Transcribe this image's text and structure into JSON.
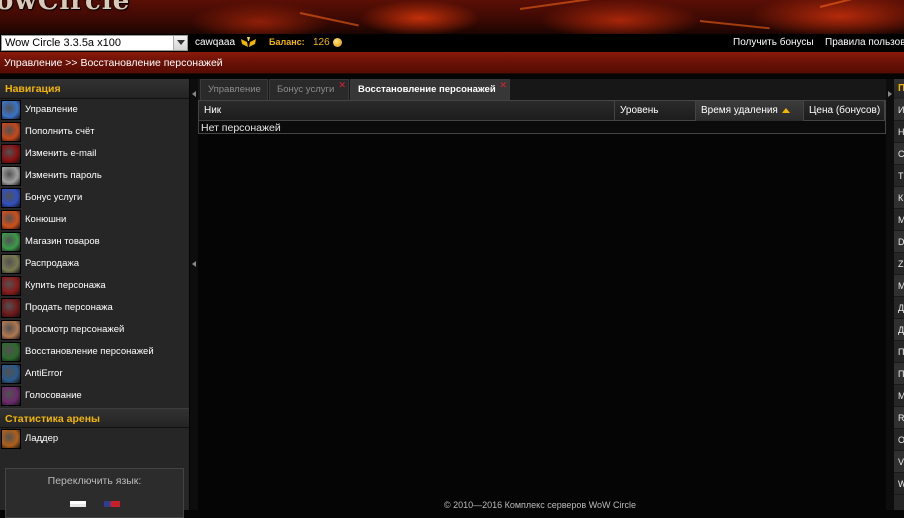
{
  "banner": {
    "logo_text": "owCircle"
  },
  "topbar": {
    "server_selected": "Wow Circle 3.3.5a x100",
    "username": "cawqaaa",
    "balance_label": "Баланс:",
    "balance_value": "126",
    "get_bonus_link": "Получить бонусы",
    "rules_link": "Правила пользов"
  },
  "breadcrumb": "Управление >> Восстановление персонажей",
  "sidebar": {
    "nav_title": "Навигация",
    "items": [
      {
        "label": "Управление",
        "icon": "shield-frost-icon",
        "color": "#3a74c8"
      },
      {
        "label": "Пополнить счёт",
        "icon": "fire-claw-icon",
        "color": "#c8481a"
      },
      {
        "label": "Изменить e-mail",
        "icon": "red-demon-icon",
        "color": "#8a1010"
      },
      {
        "label": "Изменить пароль",
        "icon": "grey-face-icon",
        "color": "#a0a0a0"
      },
      {
        "label": "Бонус услуги",
        "icon": "blue-sword-icon",
        "color": "#3050c0"
      },
      {
        "label": "Конюшни",
        "icon": "flame-horse-icon",
        "color": "#d0501a"
      },
      {
        "label": "Магазин товаров",
        "icon": "green-orb-icon",
        "color": "#3c9a4a"
      },
      {
        "label": "Распродажа",
        "icon": "potion-flask-icon",
        "color": "#7a7a50"
      },
      {
        "label": "Купить персонажа",
        "icon": "red-rune-icon",
        "color": "#8a1a1a"
      },
      {
        "label": "Продать персонажа",
        "icon": "crimson-skull-icon",
        "color": "#701818"
      },
      {
        "label": "Просмотр персонажей",
        "icon": "dwarf-portrait-icon",
        "color": "#b07850"
      },
      {
        "label": "Восстановление персонажей",
        "icon": "green-dragon-icon",
        "color": "#2e6a2e"
      },
      {
        "label": "AntiError",
        "icon": "blue-vortex-icon",
        "color": "#2a5a8a"
      },
      {
        "label": "Голосование",
        "icon": "purple-cross-icon",
        "color": "#6a2a6a"
      }
    ],
    "arena_title": "Статистика арены",
    "arena_items": [
      {
        "label": "Ладдер",
        "icon": "ladder-trophy-icon",
        "color": "#b0601a"
      }
    ],
    "lang_label": "Переключить язык:"
  },
  "tabs": [
    {
      "label": "Управление",
      "closable": false,
      "active": false
    },
    {
      "label": "Бонус услуги",
      "closable": true,
      "active": false
    },
    {
      "label": "Восстановление персонажей",
      "closable": true,
      "active": true
    }
  ],
  "grid": {
    "columns": [
      "Ник",
      "Уровень",
      "Время удаления",
      "Цена (бонусов)"
    ],
    "sorted_column": "Время удаления",
    "empty_text": "Нет персонажей"
  },
  "rightpanel": {
    "title": "П",
    "items": [
      "И",
      "Н",
      "С",
      "Т",
      "К",
      "М",
      "D",
      "Z",
      "М",
      "Д",
      "Д",
      "П",
      "П",
      "М",
      "R",
      "О",
      "V",
      "W"
    ]
  },
  "footer": "© 2010—2016 Комплекс серверов WoW Circle"
}
